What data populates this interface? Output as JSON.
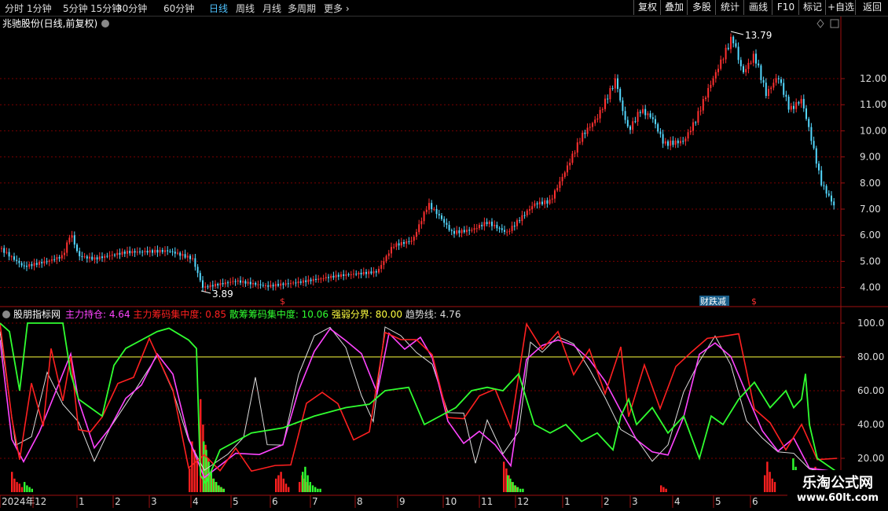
{
  "toolbar": {
    "periods": [
      {
        "label": "分时",
        "active": false
      },
      {
        "label": "1分钟",
        "active": false
      },
      {
        "label": "5分钟",
        "active": false
      },
      {
        "label": "15分钟",
        "active": false
      },
      {
        "label": "30分钟",
        "active": false
      },
      {
        "label": "60分钟",
        "active": false
      },
      {
        "label": "日线",
        "active": true
      },
      {
        "label": "周线",
        "active": false
      },
      {
        "label": "月线",
        "active": false
      },
      {
        "label": "多周期",
        "active": false
      },
      {
        "label": "更多",
        "active": false
      }
    ],
    "buttons": [
      "复权",
      "叠加",
      "多股",
      "统计",
      "画线",
      "F10",
      "标记",
      "+自选",
      "返回"
    ]
  },
  "stock_title": "兆驰股份(日线,前复权)",
  "price_axis": [
    "12.00",
    "11.00",
    "10.00",
    "9.00",
    "8.00",
    "7.00",
    "6.00",
    "5.00",
    "4.00"
  ],
  "max_price_label": "13.79",
  "min_price_label": "3.89",
  "event_badge": "财跌减",
  "event_markers": [
    "$",
    "$"
  ],
  "indicator": {
    "name": "股朋指标网",
    "items": [
      {
        "label": "主力持仓:",
        "value": "4.64",
        "color": "#ff44ff"
      },
      {
        "label": "主力筹码集中度:",
        "value": "0.85",
        "color": "#ff2020"
      },
      {
        "label": "散筹筹码集中度:",
        "value": "10.06",
        "color": "#30ff30"
      },
      {
        "label": "强弱分界:",
        "value": "80.00",
        "color": "#ffff40"
      },
      {
        "label": "趋势线:",
        "value": "4.76",
        "color": "#dddddd"
      }
    ],
    "axis": [
      "100.0",
      "80.00",
      "60.00",
      "40.00",
      "20.00"
    ]
  },
  "date_axis": [
    "2024年",
    "12",
    "1",
    "2",
    "3",
    "4",
    "5",
    "6",
    "7",
    "8",
    "9",
    "10",
    "11",
    "12",
    "1",
    "2",
    "3",
    "4",
    "5",
    "6"
  ],
  "watermark": {
    "title": "乐淘公式网",
    "url": "www.60lt.com"
  },
  "colors": {
    "up": "#ff3030",
    "down": "#54d8ff",
    "grid": "#8b0000",
    "border": "#a01010"
  }
}
